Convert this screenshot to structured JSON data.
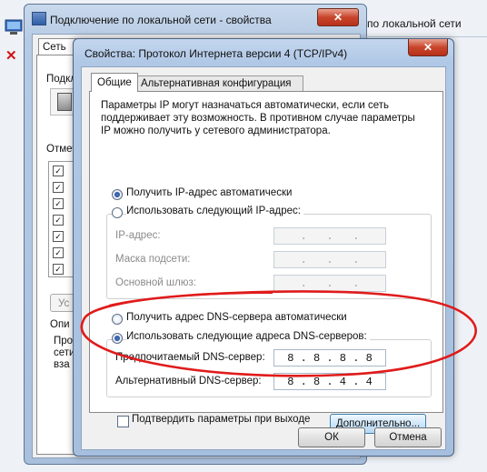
{
  "bg_window": {
    "title": "Подключение по локальной сети - свойства",
    "close_glyph": "✕",
    "tab": "Сеть",
    "connect_label": "Подкл",
    "components_label": "Отмеч",
    "checkmark": "✓",
    "install_btn": "Ус",
    "desc_label": "Опи",
    "desc_text": "Про\nсети\nвза"
  },
  "right_fragment": "по локальной сети",
  "left_x_glyph": "✕",
  "dialog": {
    "title": "Свойства: Протокол Интернета версии 4 (TCP/IPv4)",
    "close_glyph": "✕",
    "tabs": [
      {
        "label": "Общие"
      },
      {
        "label": "Альтернативная конфигурация"
      }
    ],
    "intro": "Параметры IP могут назначаться автоматически, если сеть\nподдерживает эту возможность. В противном случае параметры\nIP можно получить у сетевого администратора.",
    "ip_auto": "Получить IP-адрес автоматически",
    "ip_manual": "Использовать следующий IP-адрес:",
    "ip_fields": {
      "ip_label": "IP-адрес:",
      "mask_label": "Маска подсети:",
      "gateway_label": "Основной шлюз:",
      "empty_value": " .   .   . "
    },
    "dns_auto": "Получить адрес DNS-сервера автоматически",
    "dns_manual": "Использовать следующие адреса DNS-серверов:",
    "preferred_dns_label": "Предпочитаемый DNS-сервер:",
    "preferred_dns_value": "8 . 8 . 8 . 8",
    "alternate_dns_label": "Альтернативный DNS-сервер:",
    "alternate_dns_value": "8 . 8 . 4 . 4",
    "confirm_label": "Подтвердить параметры при выходе",
    "advanced_btn": "Дополнительно...",
    "ok_btn": "ОК",
    "cancel_btn": "Отмена"
  },
  "colors": {
    "highlight": "#e01b1b",
    "window_frame": "#b0c8e6",
    "close_button": "#c8452b"
  }
}
